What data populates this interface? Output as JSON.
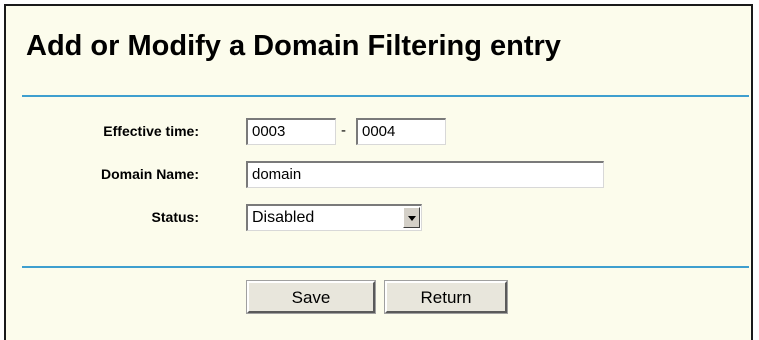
{
  "page": {
    "title": "Add or Modify a Domain Filtering entry"
  },
  "form": {
    "effective_time": {
      "label": "Effective time:",
      "start": "0003",
      "separator": "-",
      "end": "0004"
    },
    "domain_name": {
      "label": "Domain Name:",
      "value": "domain"
    },
    "status": {
      "label": "Status:",
      "selected": "Disabled"
    }
  },
  "actions": {
    "save_label": "Save",
    "return_label": "Return"
  },
  "colors": {
    "panel_background": "#fcfcec",
    "divider": "#3f9fcf",
    "button_face": "#e8e6dc"
  }
}
